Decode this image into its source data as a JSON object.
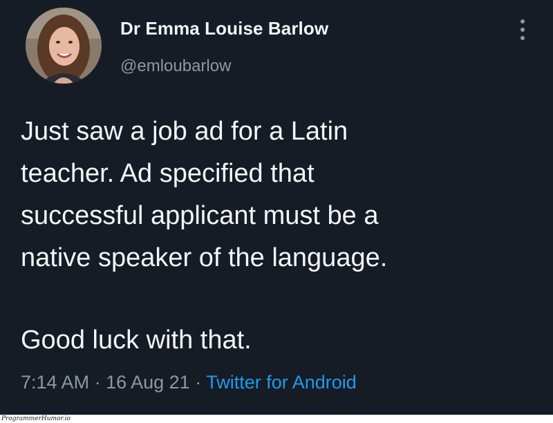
{
  "tweet": {
    "author": {
      "name": "Dr Emma Louise Barlow",
      "handle": "@emloubarlow",
      "avatar_icon": "profile-photo"
    },
    "more_icon": "more-options-icon",
    "paragraphs": [
      "Just saw a job ad for a Latin\nteacher. Ad specified that\nsuccessful applicant must be a\nnative speaker of the language.",
      "Good luck with that."
    ],
    "meta": {
      "time": "7:14 AM",
      "separator_1": " · ",
      "date": "16 Aug 21",
      "separator_2": " · ",
      "source": "Twitter for Android"
    }
  },
  "watermark": "ProgrammerHumor.io",
  "colors": {
    "background": "#15202b",
    "link": "#1d9bf0",
    "secondary_text": "#8b98a5"
  }
}
